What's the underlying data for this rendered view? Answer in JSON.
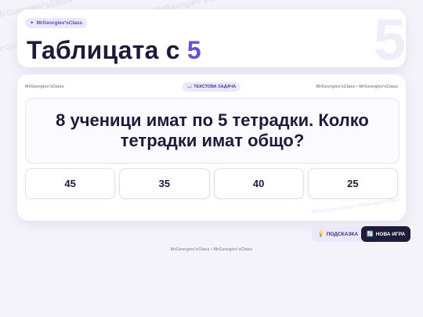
{
  "watermark": "MrGeorgiev'sClass",
  "header": {
    "brand_chip": "MrGeorgiev'sClass",
    "brand_chip_icon": "✦",
    "title_prefix": "Таблицата с",
    "title_number": "5",
    "bg_number": "5"
  },
  "game": {
    "left_brand": "MrGeorgiev'sClass",
    "task_icon": "📖",
    "task_label": "ТЕКСТОВА ЗАДАЧА",
    "right_brand": "MrGeorgiev'sClass • MrGeorgiev'sClass",
    "question": "8 ученици имат по 5 тетрадки. Колко тетрадки имат общо?",
    "answers": [
      "45",
      "35",
      "40",
      "25"
    ],
    "card_watermark": "MrGeorgiev'sClass • MrGeorgiev'sClass"
  },
  "actions": {
    "hint_icon": "💡",
    "hint_label": "ПОДСКАЗКА",
    "new_game_icon": "🔄",
    "new_game_label": "НОВА ИГРА"
  },
  "footer": {
    "brand": "MrGeorgiev'sClass • MrGeorgiev'sClass"
  }
}
